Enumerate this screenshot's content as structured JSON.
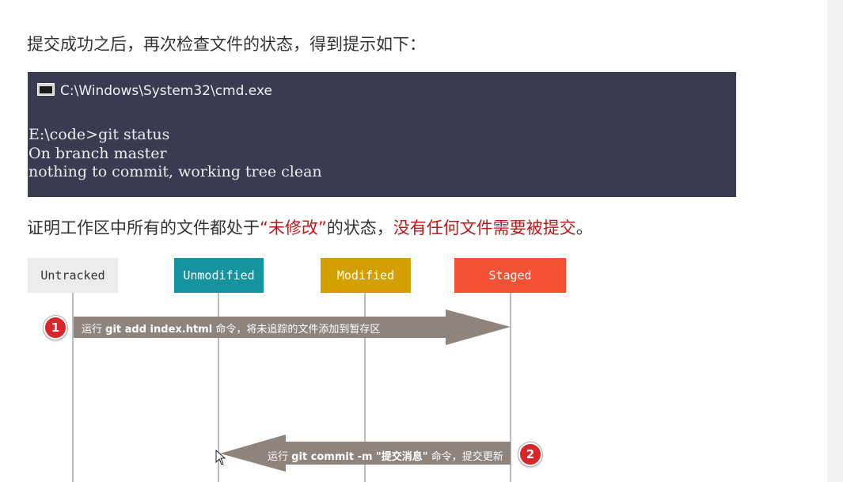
{
  "intro_text": "提交成功之后，再次检查文件的状态，得到提示如下：",
  "terminal": {
    "title": "C:\\Windows\\System32\\cmd.exe",
    "lines": [
      "E:\\code>git status",
      "On branch master",
      "nothing to commit, working tree clean"
    ]
  },
  "conclusion": {
    "before": "证明工作区中所有的文件都处于",
    "highlight1": "“未修改”",
    "middle": "的状态，",
    "highlight2": "没有任何文件需要被提交",
    "after": "。"
  },
  "states": [
    {
      "label": "Untracked",
      "bg": "#ececec",
      "fg": "#333333"
    },
    {
      "label": "Unmodified",
      "bg": "#15939f",
      "fg": "#ffffff"
    },
    {
      "label": "Modified",
      "bg": "#d3a000",
      "fg": "#ffffff"
    },
    {
      "label": "Staged",
      "bg": "#f35034",
      "fg": "#ffffff"
    }
  ],
  "steps": [
    {
      "number": "1",
      "pre": "运行 ",
      "cmd": "git add index.html",
      "post": " 命令，将未追踪的文件添加到暂存区"
    },
    {
      "number": "2",
      "pre": "运行 ",
      "cmd": "git commit -m \"提交消息\"",
      "post": " 命令，提交更新"
    }
  ],
  "colors": {
    "arrow": "#8e847c",
    "terminal_bg": "#3a3b51",
    "highlight": "#c01818",
    "badge": "#d8262a"
  }
}
